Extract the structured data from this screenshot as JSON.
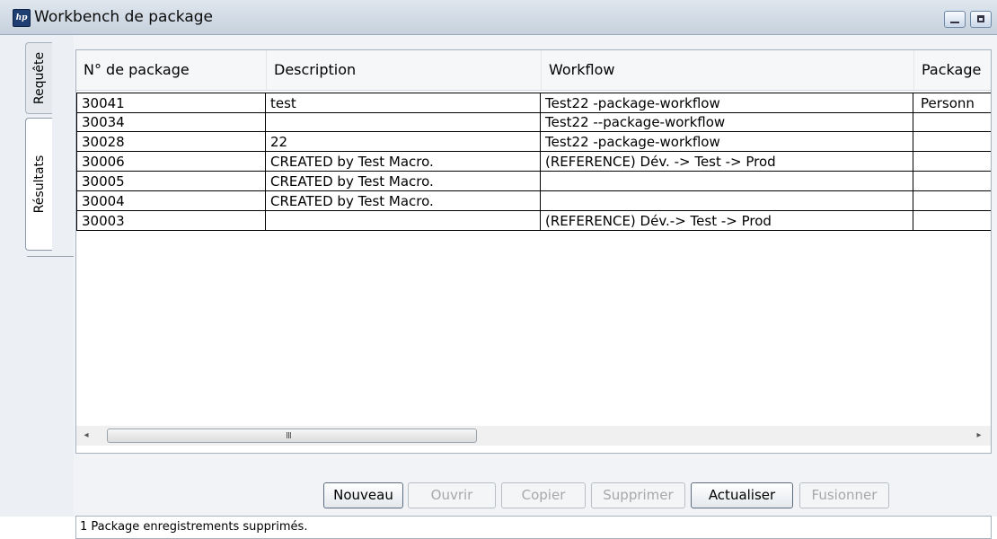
{
  "window": {
    "title": "Workbench de package",
    "logo_text": "hp",
    "minimize_icon": "minimize-icon",
    "maximize_icon": "maximize-icon"
  },
  "sidebar": {
    "tabs": [
      {
        "label": "Requête",
        "selected": false
      },
      {
        "label": "Résultats",
        "selected": true
      }
    ]
  },
  "table": {
    "columns": [
      "N° de package",
      "Description",
      "Workflow",
      "Package"
    ],
    "rows": [
      [
        "30041",
        "test",
        "Test22 -package-workflow",
        "Personn"
      ],
      [
        "30034",
        "",
        "Test22 --package-workflow",
        ""
      ],
      [
        "30028",
        "22",
        "Test22 -package-workflow",
        ""
      ],
      [
        "30006",
        "CREATED by Test Macro.",
        "(REFERENCE) Dév. -> Test -> Prod",
        ""
      ],
      [
        "30005",
        "CREATED by Test Macro.",
        "",
        ""
      ],
      [
        "30004",
        "CREATED by Test Macro.",
        "",
        ""
      ],
      [
        "30003",
        "",
        "(REFERENCE) Dév.-> Test -> Prod",
        ""
      ]
    ]
  },
  "scrollbar": {
    "left_arrow": "◂",
    "right_arrow": "▸",
    "grip": "III"
  },
  "buttons": [
    {
      "label": "Nouveau",
      "enabled": true
    },
    {
      "label": "Ouvrir",
      "enabled": false
    },
    {
      "label": "Copier",
      "enabled": false
    },
    {
      "label": "Supprimer",
      "enabled": false
    },
    {
      "label": "Actualiser",
      "enabled": true
    },
    {
      "label": "Fusionner",
      "enabled": false
    }
  ],
  "status": {
    "text": "1 Package enregistrements supprimés."
  }
}
